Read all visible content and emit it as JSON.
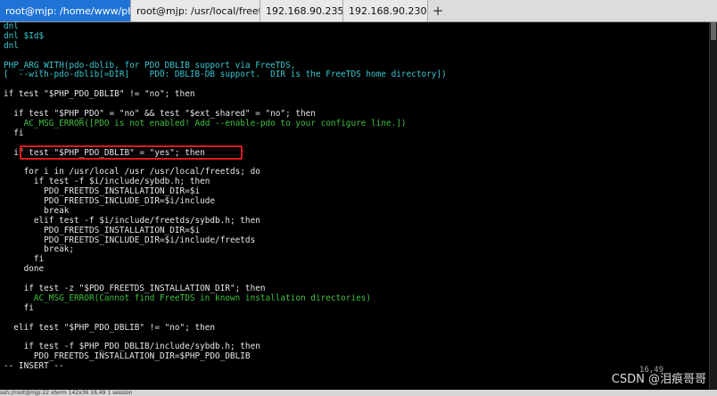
{
  "tabs": [
    {
      "label": "root@mjp: /home/www/php/...",
      "active": true
    },
    {
      "label": "root@mjp: /usr/local/freetds",
      "active": false
    },
    {
      "label": "192.168.90.235",
      "active": false
    },
    {
      "label": "192.168.90.230",
      "active": false
    }
  ],
  "tab_close_symbol": "×",
  "new_tab_symbol": "+",
  "terminal_lines": [
    {
      "text": "dnl",
      "color": "cyan"
    },
    {
      "text": "dnl $Id$",
      "color": "cyan"
    },
    {
      "text": "dnl",
      "color": "cyan"
    },
    {
      "text": "",
      "color": "default"
    },
    {
      "text": "PHP_ARG_WITH(pdo-dblib, for PDO_DBLIB support via FreeTDS,",
      "color": "cyan"
    },
    {
      "text": "[  --with-pdo-dblib[=DIR]    PDO: DBLIB-DB support.  DIR is the FreeTDS home directory])",
      "color": "cyan"
    },
    {
      "text": "",
      "color": "default"
    },
    {
      "text": "if test \"$PHP_PDO_DBLIB\" != \"no\"; then",
      "color": "default"
    },
    {
      "text": "",
      "color": "default"
    },
    {
      "text": "  if test \"$PHP_PDO\" = \"no\" && test \"$ext_shared\" = \"no\"; then",
      "color": "default"
    },
    {
      "text": "    AC_MSG_ERROR([PDO is not enabled! Add --enable-pdo to your configure line.])",
      "color": "green"
    },
    {
      "text": "  fi",
      "color": "default"
    },
    {
      "text": "",
      "color": "default"
    },
    {
      "text": "  if test \"$PHP_PDO_DBLIB\" = \"yes\"; then",
      "color": "default"
    },
    {
      "text": "",
      "color": "default"
    },
    {
      "text": "    for i in /usr/local /usr /usr/local/freetds; do",
      "color": "default"
    },
    {
      "text": "      if test -f $i/include/sybdb.h; then",
      "color": "default"
    },
    {
      "text": "        PDO_FREETDS_INSTALLATION_DIR=$i",
      "color": "default"
    },
    {
      "text": "        PDO_FREETDS_INCLUDE_DIR=$i/include",
      "color": "default"
    },
    {
      "text": "        break",
      "color": "default"
    },
    {
      "text": "      elif test -f $i/include/freetds/sybdb.h; then",
      "color": "default"
    },
    {
      "text": "        PDO_FREETDS_INSTALLATION_DIR=$i",
      "color": "default"
    },
    {
      "text": "        PDO_FREETDS_INCLUDE_DIR=$i/include/freetds",
      "color": "default"
    },
    {
      "text": "        break;",
      "color": "default"
    },
    {
      "text": "      fi",
      "color": "default"
    },
    {
      "text": "    done",
      "color": "default"
    },
    {
      "text": "",
      "color": "default"
    },
    {
      "text": "    if test -z \"$PDO_FREETDS_INSTALLATION_DIR\"; then",
      "color": "default"
    },
    {
      "text": "      AC_MSG_ERROR(Cannot find FreeTDS in known installation directories)",
      "color": "green"
    },
    {
      "text": "    fi",
      "color": "default"
    },
    {
      "text": "",
      "color": "default"
    },
    {
      "text": "  elif test \"$PHP_PDO_DBLIB\" != \"no\"; then",
      "color": "default"
    },
    {
      "text": "",
      "color": "default"
    },
    {
      "text": "    if test -f $PHP_PDO_DBLIB/include/sybdb.h; then",
      "color": "default"
    },
    {
      "text": "      PDO_FREETDS_INSTALLATION_DIR=$PHP_PDO_DBLIB",
      "color": "default"
    },
    {
      "text": "-- INSERT --",
      "color": "default"
    }
  ],
  "cursor_position": "16,49",
  "watermark": "CSDN @泪痕哥哥",
  "statusbar_text": "ssh://root@mjp:22    xterm    142x36    16,49    1 session"
}
